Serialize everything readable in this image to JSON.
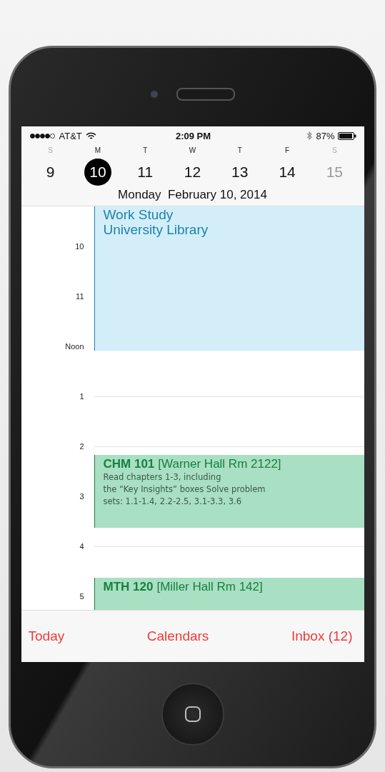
{
  "status_bar": {
    "carrier": "AT&T",
    "time": "2:09 PM",
    "battery": "87%"
  },
  "week": [
    {
      "letter": "S",
      "date": "9",
      "selected": false,
      "weekend": true,
      "dimmed": false
    },
    {
      "letter": "M",
      "date": "10",
      "selected": true,
      "weekend": false,
      "dimmed": false
    },
    {
      "letter": "T",
      "date": "11",
      "selected": false,
      "weekend": false,
      "dimmed": false
    },
    {
      "letter": "W",
      "date": "12",
      "selected": false,
      "weekend": false,
      "dimmed": false
    },
    {
      "letter": "T",
      "date": "13",
      "selected": false,
      "weekend": false,
      "dimmed": false
    },
    {
      "letter": "F",
      "date": "14",
      "selected": false,
      "weekend": false,
      "dimmed": false
    },
    {
      "letter": "S",
      "date": "15",
      "selected": false,
      "weekend": true,
      "dimmed": true
    }
  ],
  "date_title": "Monday  February 10, 2014",
  "hours": [
    "10",
    "11",
    "Noon",
    "1",
    "2",
    "3",
    "4",
    "5"
  ],
  "events": [
    {
      "kind": "work",
      "color": "#1d84ad",
      "title": "Work Study",
      "location": "University Library"
    },
    {
      "kind": "class",
      "color": "#17803f",
      "title": "CHM 101",
      "location": "[Warner Hall Rm 2122]",
      "notes": "Read chapters 1-3, including\nthe “Key Insights” boxes Solve problem\nsets: 1.1-1.4, 2.2-2.5, 3.1-3.3, 3.6"
    },
    {
      "kind": "class",
      "color": "#17803f",
      "title": "MTH 120",
      "location": "[Miller Hall Rm 142]"
    }
  ],
  "tab_bar": [
    "Today",
    "Calendars",
    "Inbox (12)"
  ]
}
